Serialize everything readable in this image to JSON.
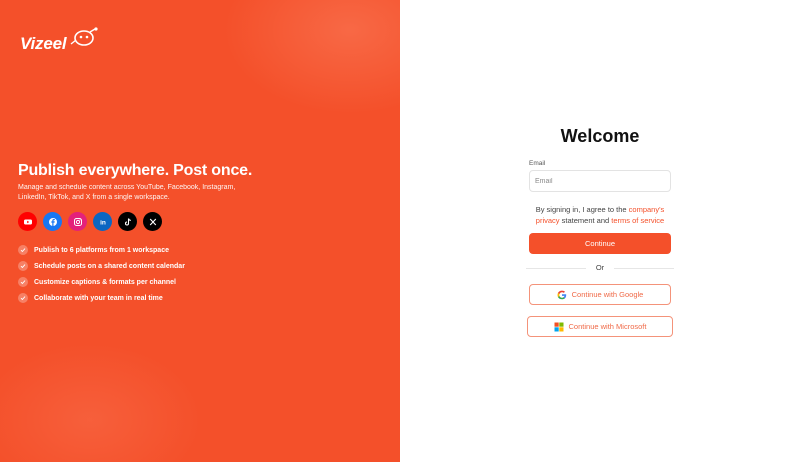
{
  "brand": {
    "name": "Vizeel",
    "accent": "#f4502a"
  },
  "hero": {
    "headline": "Publish everywhere. Post once.",
    "subline": "Manage and schedule content across YouTube, Facebook, Instagram, LinkedIn, TikTok, and X from a single workspace."
  },
  "socials": [
    {
      "name": "youtube-icon",
      "color": "#ff0000"
    },
    {
      "name": "facebook-icon",
      "color": "#1877f2"
    },
    {
      "name": "instagram-icon",
      "color": "#e4217b"
    },
    {
      "name": "linkedin-icon",
      "color": "#0a66c2"
    },
    {
      "name": "tiktok-icon",
      "color": "#000000"
    },
    {
      "name": "x-icon",
      "color": "#000000"
    }
  ],
  "features": [
    {
      "label": "Publish to 6 platforms from 1 workspace"
    },
    {
      "label": "Schedule posts on a shared content calendar"
    },
    {
      "label": "Customize captions & formats per channel"
    },
    {
      "label": "Collaborate with your team in real time"
    }
  ],
  "login": {
    "title": "Welcome",
    "email_label": "Email",
    "email_placeholder": "Email",
    "email_value": "",
    "terms_prefix": "By signing in, I agree to the",
    "terms_link1": "company's privacy",
    "terms_middle": "statement and",
    "terms_link2": "terms of service",
    "continue_label": "Continue",
    "or_label": "Or",
    "google_label": "Continue with Google",
    "microsoft_label": "Continue with Microsoft"
  }
}
